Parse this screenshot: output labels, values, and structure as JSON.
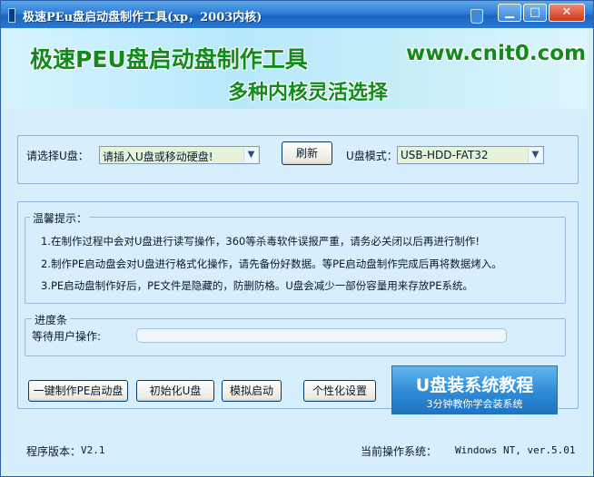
{
  "window": {
    "title": "极速PEu盘启动盘制作工具(xp，2003内核)"
  },
  "banner": {
    "title": "极速PEU盘启动盘制作工具",
    "subtitle": "多种内核灵活选择",
    "url": "www.cnit0.com"
  },
  "select": {
    "drive_label": "请选择U盘：",
    "drive_value": "请插入U盘或移动硬盘!",
    "refresh_label": "刷新",
    "mode_label": "U盘模式：",
    "mode_value": "USB-HDD-FAT32"
  },
  "tips": {
    "legend": "温馨提示：",
    "items": [
      "1.在制作过程中会对U盘进行读写操作，360等杀毒软件误报严重，请务必关闭以后再进行制作!",
      "2.制作PE启动盘会对U盘进行格式化操作，请先备份好数据。等PE启动盘制作完成后再将数据烤入。",
      "3.PE启动盘制作好后，PE文件是隐藏的，防删防格。U盘会减少一部份容量用来存放PE系统。"
    ]
  },
  "progress": {
    "legend": "进度条",
    "status": "等待用户操作:",
    "value": 0
  },
  "actions": {
    "make_label": "一键制作PE启动盘",
    "init_label": "初始化U盘",
    "simulate_label": "模拟启动",
    "custom_label": "个性化设置"
  },
  "tutorial": {
    "title": "U盘装系统教程",
    "subtitle": "3分钟教你学会装系统"
  },
  "footer": {
    "version_label": "程序版本：",
    "version_value": "V2.1",
    "os_label": "当前操作系统：",
    "os_value": "Windows NT, ver.5.01"
  },
  "colors": {
    "accent_green": "#128a1d",
    "title_blue": "#1c64bd",
    "progress_green": "#56b64a"
  }
}
